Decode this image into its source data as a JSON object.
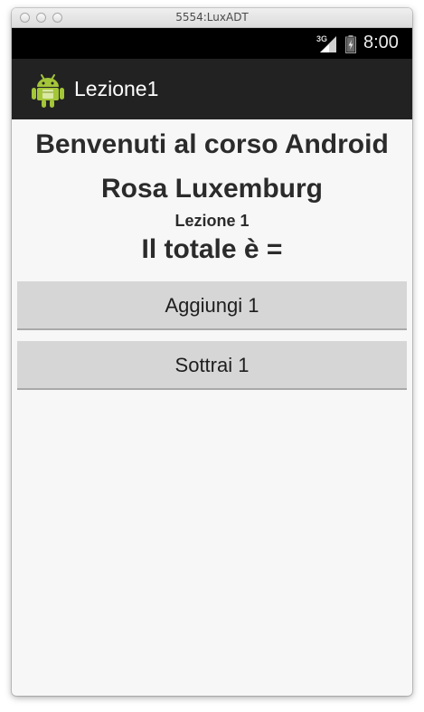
{
  "window": {
    "title": "5554:LuxADT"
  },
  "statusbar": {
    "network": "3G",
    "time": "8:00"
  },
  "actionbar": {
    "title": "Lezione1"
  },
  "main": {
    "headline": "Benvenuti al corso Android Rosa Luxemburg",
    "lesson": "Lezione 1",
    "total": "Il totale è =",
    "add_button": "Aggiungi 1",
    "subtract_button": "Sottrai 1"
  },
  "colors": {
    "actionbar": "#222222",
    "background": "#f7f7f7",
    "button": "#d6d6d6",
    "android_green": "#a4c639"
  }
}
